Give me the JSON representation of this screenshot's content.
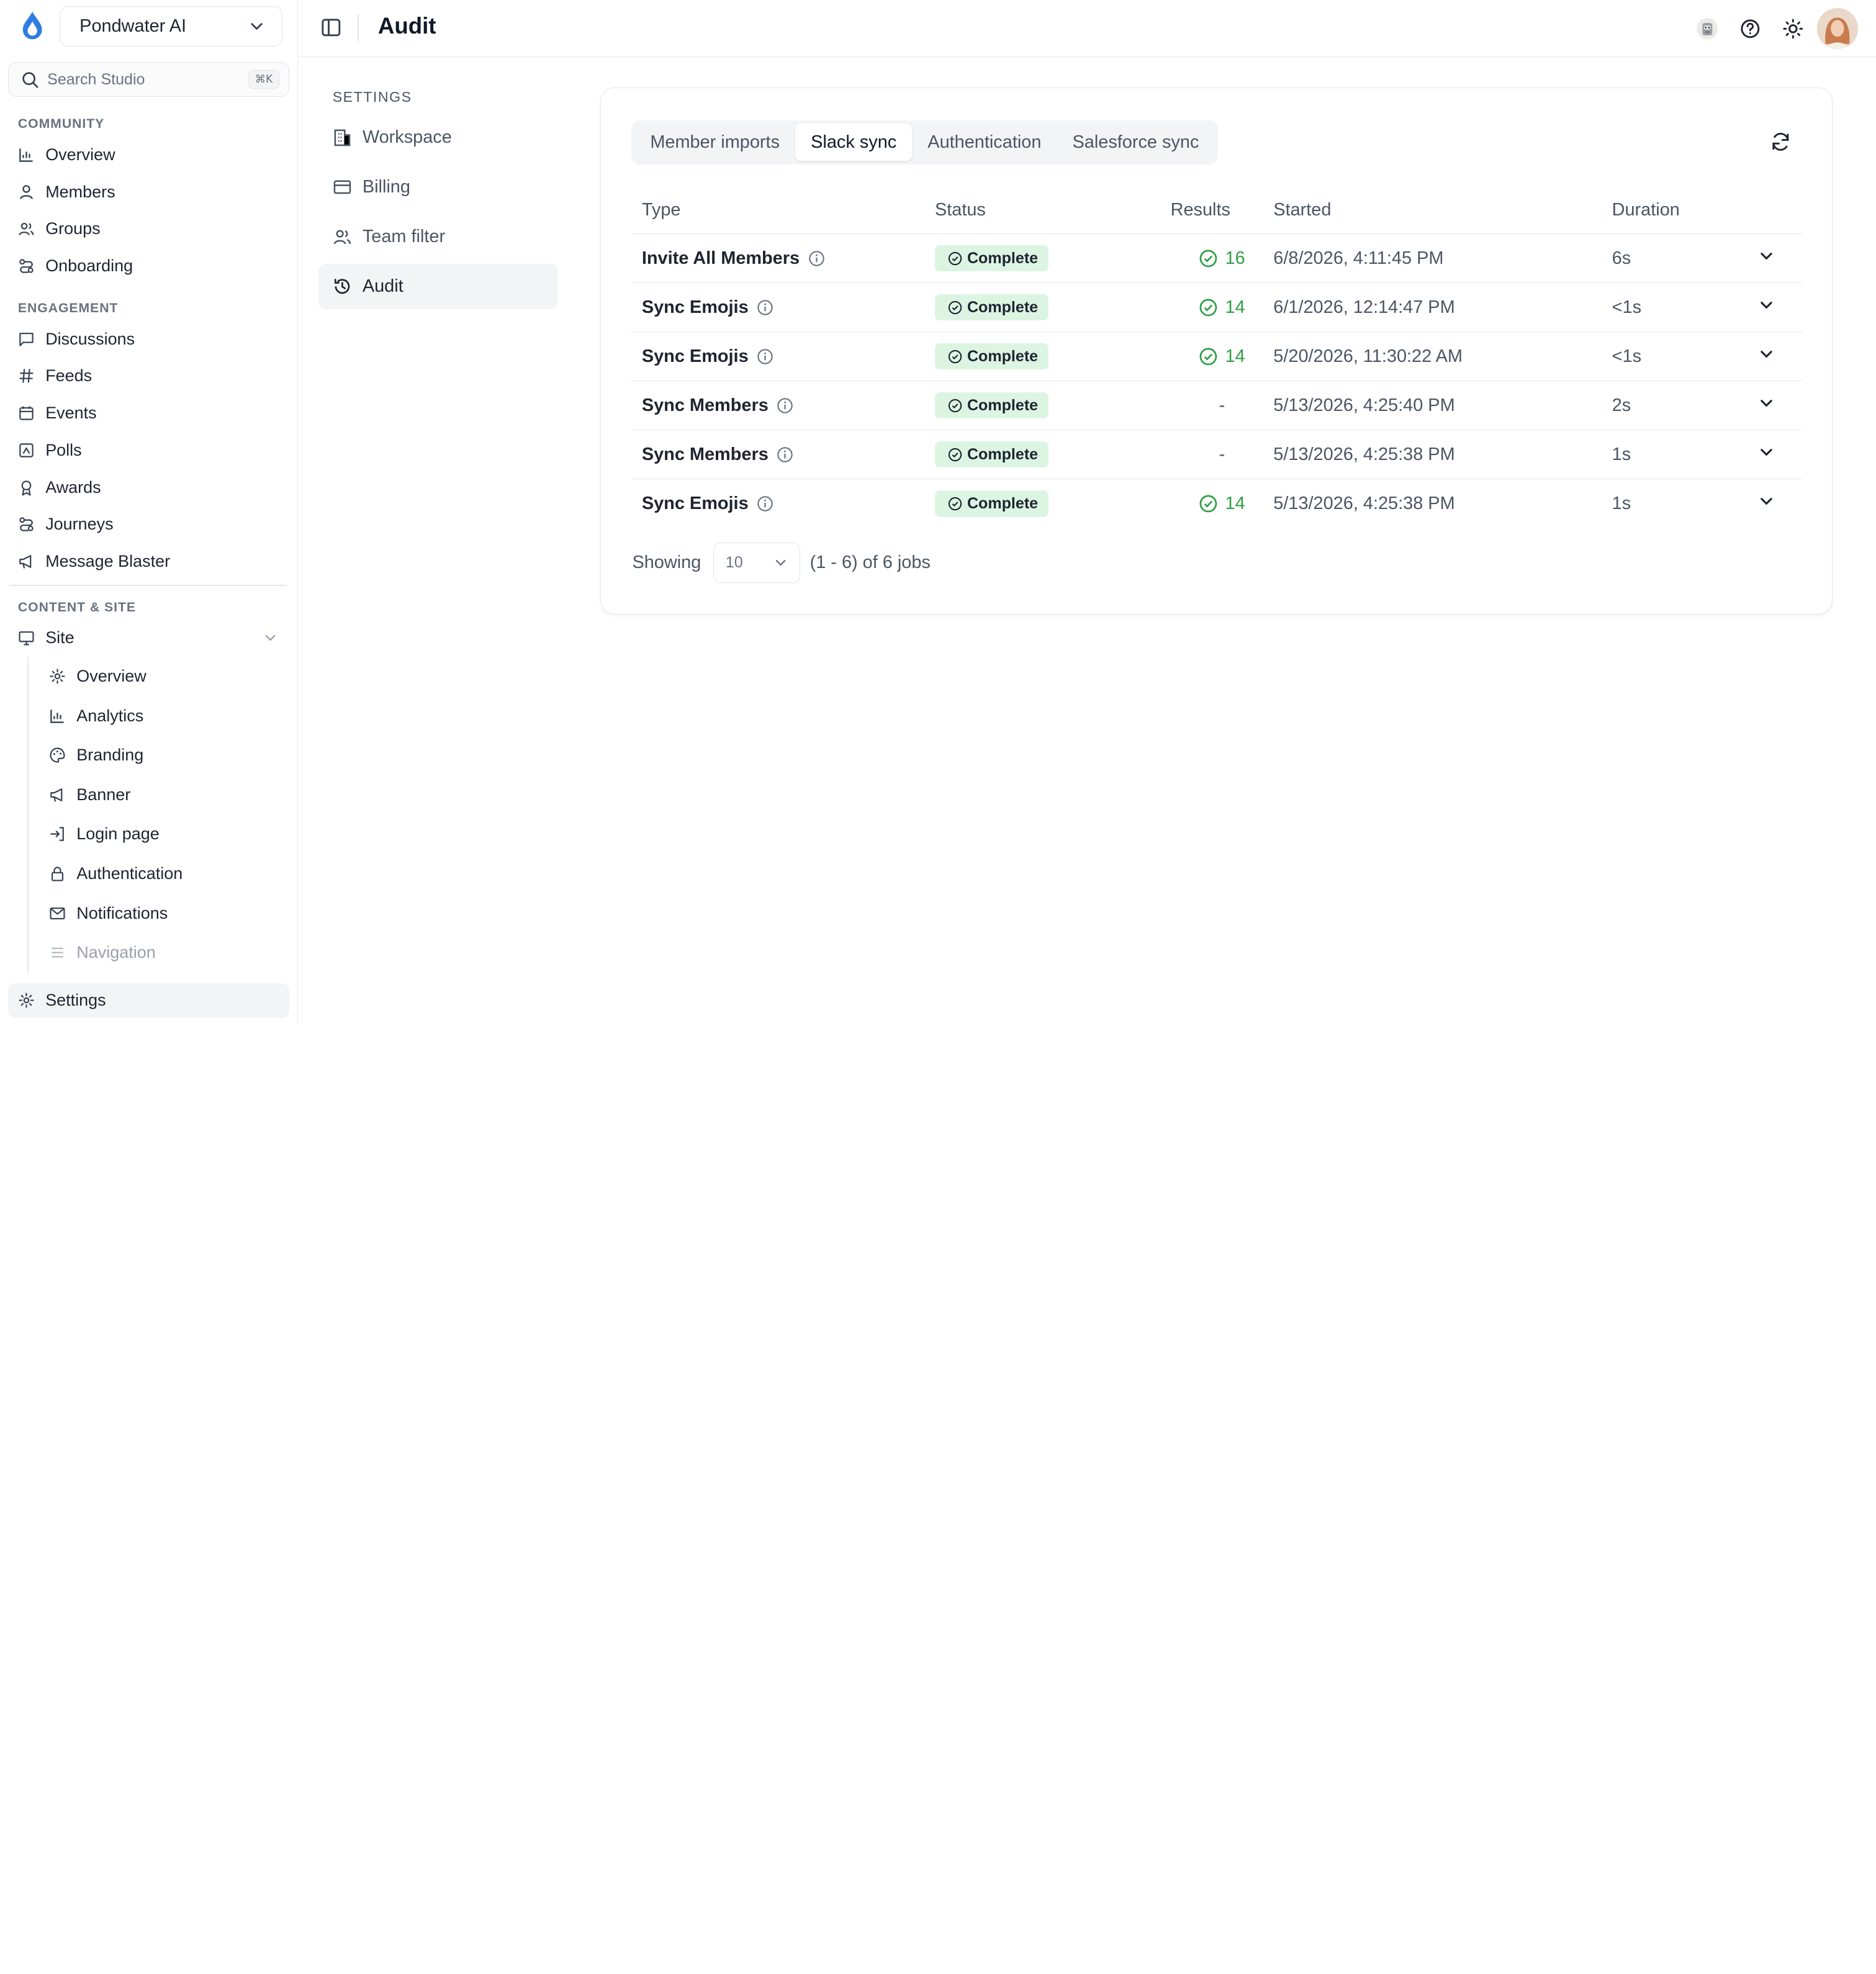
{
  "workspace": {
    "name": "Pondwater AI"
  },
  "search": {
    "placeholder": "Search Studio",
    "shortcut": "⌘K"
  },
  "sidebar": {
    "sections": {
      "community": "COMMUNITY",
      "engagement": "ENGAGEMENT",
      "content": "CONTENT & SITE"
    },
    "community_items": [
      "Overview",
      "Members",
      "Groups",
      "Onboarding"
    ],
    "engagement_items": [
      "Discussions",
      "Feeds",
      "Events",
      "Polls",
      "Awards",
      "Journeys",
      "Message Blaster"
    ],
    "site_label": "Site",
    "site_items": [
      "Overview",
      "Analytics",
      "Branding",
      "Banner",
      "Login page",
      "Authentication",
      "Notifications",
      "Navigation"
    ],
    "settings_label": "Settings"
  },
  "topbar": {
    "title": "Audit"
  },
  "subnav": {
    "title": "SETTINGS",
    "items": [
      "Workspace",
      "Billing",
      "Team filter",
      "Audit"
    ],
    "active": "Audit"
  },
  "tabs": {
    "items": [
      "Member imports",
      "Slack sync",
      "Authentication",
      "Salesforce sync"
    ],
    "active": "Slack sync"
  },
  "table": {
    "headers": {
      "type": "Type",
      "status": "Status",
      "results": "Results",
      "started": "Started",
      "duration": "Duration"
    },
    "rows": [
      {
        "type": "Invite All Members",
        "status": "Complete",
        "results": "16",
        "started": "6/8/2026, 4:11:45 PM",
        "duration": "6s"
      },
      {
        "type": "Sync Emojis",
        "status": "Complete",
        "results": "14",
        "started": "6/1/2026, 12:14:47 PM",
        "duration": "<1s"
      },
      {
        "type": "Sync Emojis",
        "status": "Complete",
        "results": "14",
        "started": "5/20/2026, 11:30:22 AM",
        "duration": "<1s"
      },
      {
        "type": "Sync Members",
        "status": "Complete",
        "results": "-",
        "started": "5/13/2026, 4:25:40 PM",
        "duration": "2s"
      },
      {
        "type": "Sync Members",
        "status": "Complete",
        "results": "-",
        "started": "5/13/2026, 4:25:38 PM",
        "duration": "1s"
      },
      {
        "type": "Sync Emojis",
        "status": "Complete",
        "results": "14",
        "started": "5/13/2026, 4:25:38 PM",
        "duration": "1s"
      }
    ]
  },
  "pager": {
    "showing_label": "Showing",
    "page_size": "10",
    "range_text": "(1 - 6) of 6 jobs"
  },
  "colors": {
    "accent_green": "#2f9e44",
    "badge_bg": "#dcf5e3",
    "logo_blue": "#2f7de1"
  }
}
